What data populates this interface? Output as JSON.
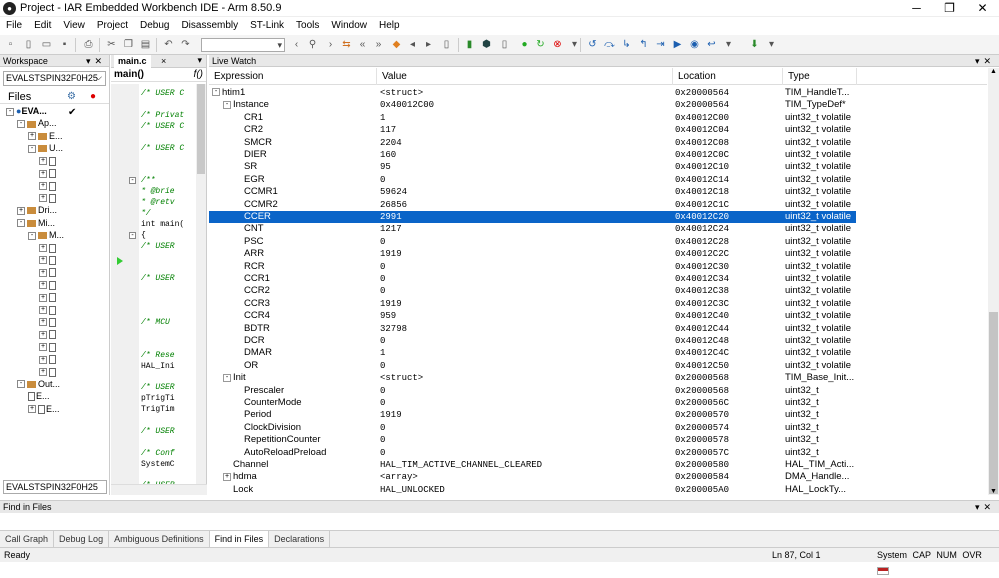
{
  "window": {
    "title": "Project - IAR Embedded Workbench IDE - Arm 8.50.9",
    "app_icon": "iar-app-icon"
  },
  "menu": [
    "File",
    "Edit",
    "View",
    "Project",
    "Debug",
    "Disassembly",
    "ST-Link",
    "Tools",
    "Window",
    "Help"
  ],
  "workspace": {
    "header": "Workspace",
    "config": "EVALSTSPIN32F0H25",
    "files_label": "Files",
    "bottom_tab": "EVALSTSPIN32F0H25",
    "tree": [
      {
        "label": "EVA...",
        "depth": 0,
        "type": "project",
        "sign": "-"
      },
      {
        "label": "Ap...",
        "depth": 1,
        "type": "folder",
        "sign": "-"
      },
      {
        "label": "E...",
        "depth": 2,
        "type": "folder",
        "sign": "+"
      },
      {
        "label": "U...",
        "depth": 2,
        "type": "folder",
        "sign": "-"
      },
      {
        "label": "",
        "depth": 3,
        "type": "file",
        "sign": "+"
      },
      {
        "label": "",
        "depth": 3,
        "type": "file",
        "sign": "+"
      },
      {
        "label": "",
        "depth": 3,
        "type": "file",
        "sign": "+"
      },
      {
        "label": "",
        "depth": 3,
        "type": "file",
        "sign": "+"
      },
      {
        "label": "Dri...",
        "depth": 1,
        "type": "folder",
        "sign": "+"
      },
      {
        "label": "Mi...",
        "depth": 1,
        "type": "folder",
        "sign": "-"
      },
      {
        "label": "M...",
        "depth": 2,
        "type": "folder",
        "sign": "-"
      },
      {
        "label": "",
        "depth": 3,
        "type": "file",
        "sign": "+"
      },
      {
        "label": "",
        "depth": 3,
        "type": "file",
        "sign": "+"
      },
      {
        "label": "",
        "depth": 3,
        "type": "file",
        "sign": "+"
      },
      {
        "label": "",
        "depth": 3,
        "type": "file",
        "sign": "+"
      },
      {
        "label": "",
        "depth": 3,
        "type": "file",
        "sign": "+"
      },
      {
        "label": "",
        "depth": 3,
        "type": "file",
        "sign": "+"
      },
      {
        "label": "",
        "depth": 3,
        "type": "file",
        "sign": "+"
      },
      {
        "label": "",
        "depth": 3,
        "type": "file",
        "sign": "+"
      },
      {
        "label": "",
        "depth": 3,
        "type": "file",
        "sign": "+"
      },
      {
        "label": "",
        "depth": 3,
        "type": "file",
        "sign": "+"
      },
      {
        "label": "",
        "depth": 3,
        "type": "file",
        "sign": "+"
      },
      {
        "label": "Out...",
        "depth": 1,
        "type": "folder",
        "sign": "-"
      },
      {
        "label": "E...",
        "depth": 2,
        "type": "file",
        "sign": ""
      },
      {
        "label": "E...",
        "depth": 2,
        "type": "file",
        "sign": "+"
      }
    ]
  },
  "editor": {
    "tab": "main.c",
    "tab_close": "×",
    "function": "main()",
    "fn_icon": "f()",
    "lines": [
      {
        "t": "/* USER C",
        "c": true
      },
      {
        "t": "",
        "c": false
      },
      {
        "t": "/* Privat",
        "c": true
      },
      {
        "t": "/* USER C",
        "c": true
      },
      {
        "t": "",
        "c": false
      },
      {
        "t": "/* USER C",
        "c": true
      },
      {
        "t": "",
        "c": false
      },
      {
        "t": "",
        "c": false
      },
      {
        "t": "/**",
        "c": true
      },
      {
        "t": "  * @brie",
        "c": true
      },
      {
        "t": "  * @retv",
        "c": true
      },
      {
        "t": "  */",
        "c": true
      },
      {
        "t": "int main(",
        "c": false
      },
      {
        "t": "{",
        "c": false
      },
      {
        "t": "  /* USER",
        "c": true
      },
      {
        "t": "",
        "c": false
      },
      {
        "t": "",
        "c": false
      },
      {
        "t": "  /* USER",
        "c": true
      },
      {
        "t": "",
        "c": false
      },
      {
        "t": "",
        "c": false
      },
      {
        "t": "",
        "c": false
      },
      {
        "t": "  /* MCU",
        "c": true
      },
      {
        "t": "",
        "c": false
      },
      {
        "t": "",
        "c": false
      },
      {
        "t": "  /* Rese",
        "c": true
      },
      {
        "t": "  HAL_Ini",
        "c": false
      },
      {
        "t": "",
        "c": false
      },
      {
        "t": "  /* USER",
        "c": true
      },
      {
        "t": "  pTrigTi",
        "c": false
      },
      {
        "t": "  TrigTim",
        "c": false
      },
      {
        "t": "",
        "c": false
      },
      {
        "t": "  /* USER",
        "c": true
      },
      {
        "t": "",
        "c": false
      },
      {
        "t": "  /* Conf",
        "c": true
      },
      {
        "t": "  SystemC",
        "c": false
      },
      {
        "t": "",
        "c": false
      },
      {
        "t": "  /* USER",
        "c": true
      }
    ]
  },
  "watch": {
    "header": "Live Watch",
    "columns": [
      "Expression",
      "Value",
      "Location",
      "Type"
    ],
    "rows": [
      {
        "e": "htim1",
        "d": 0,
        "s": "-",
        "v": "<struct>",
        "l": "0x20000564",
        "t": "TIM_HandleT..."
      },
      {
        "e": "Instance",
        "d": 1,
        "s": "-",
        "v": "0x40012C00",
        "l": "0x20000564",
        "t": "TIM_TypeDef*"
      },
      {
        "e": "CR1",
        "d": 2,
        "s": "",
        "v": "1",
        "l": "0x40012C00",
        "t": "uint32_t volatile"
      },
      {
        "e": "CR2",
        "d": 2,
        "s": "",
        "v": "117",
        "l": "0x40012C04",
        "t": "uint32_t volatile"
      },
      {
        "e": "SMCR",
        "d": 2,
        "s": "",
        "v": "2204",
        "l": "0x40012C08",
        "t": "uint32_t volatile"
      },
      {
        "e": "DIER",
        "d": 2,
        "s": "",
        "v": "160",
        "l": "0x40012C0C",
        "t": "uint32_t volatile"
      },
      {
        "e": "SR",
        "d": 2,
        "s": "",
        "v": "95",
        "l": "0x40012C10",
        "t": "uint32_t volatile"
      },
      {
        "e": "EGR",
        "d": 2,
        "s": "",
        "v": "0",
        "l": "0x40012C14",
        "t": "uint32_t volatile"
      },
      {
        "e": "CCMR1",
        "d": 2,
        "s": "",
        "v": "59624",
        "l": "0x40012C18",
        "t": "uint32_t volatile"
      },
      {
        "e": "CCMR2",
        "d": 2,
        "s": "",
        "v": "26856",
        "l": "0x40012C1C",
        "t": "uint32_t volatile"
      },
      {
        "e": "CCER",
        "d": 2,
        "s": "",
        "v": "2991",
        "l": "0x40012C20",
        "t": "uint32_t volatile",
        "sel": true
      },
      {
        "e": "CNT",
        "d": 2,
        "s": "",
        "v": "1217",
        "l": "0x40012C24",
        "t": "uint32_t volatile"
      },
      {
        "e": "PSC",
        "d": 2,
        "s": "",
        "v": "0",
        "l": "0x40012C28",
        "t": "uint32_t volatile"
      },
      {
        "e": "ARR",
        "d": 2,
        "s": "",
        "v": "1919",
        "l": "0x40012C2C",
        "t": "uint32_t volatile"
      },
      {
        "e": "RCR",
        "d": 2,
        "s": "",
        "v": "0",
        "l": "0x40012C30",
        "t": "uint32_t volatile"
      },
      {
        "e": "CCR1",
        "d": 2,
        "s": "",
        "v": "0",
        "l": "0x40012C34",
        "t": "uint32_t volatile"
      },
      {
        "e": "CCR2",
        "d": 2,
        "s": "",
        "v": "0",
        "l": "0x40012C38",
        "t": "uint32_t volatile"
      },
      {
        "e": "CCR3",
        "d": 2,
        "s": "",
        "v": "1919",
        "l": "0x40012C3C",
        "t": "uint32_t volatile"
      },
      {
        "e": "CCR4",
        "d": 2,
        "s": "",
        "v": "959",
        "l": "0x40012C40",
        "t": "uint32_t volatile"
      },
      {
        "e": "BDTR",
        "d": 2,
        "s": "",
        "v": "32798",
        "l": "0x40012C44",
        "t": "uint32_t volatile"
      },
      {
        "e": "DCR",
        "d": 2,
        "s": "",
        "v": "0",
        "l": "0x40012C48",
        "t": "uint32_t volatile"
      },
      {
        "e": "DMAR",
        "d": 2,
        "s": "",
        "v": "1",
        "l": "0x40012C4C",
        "t": "uint32_t volatile"
      },
      {
        "e": "OR",
        "d": 2,
        "s": "",
        "v": "0",
        "l": "0x40012C50",
        "t": "uint32_t volatile"
      },
      {
        "e": "Init",
        "d": 1,
        "s": "-",
        "v": "<struct>",
        "l": "0x20000568",
        "t": "TIM_Base_Init..."
      },
      {
        "e": "Prescaler",
        "d": 2,
        "s": "",
        "v": "0",
        "l": "0x20000568",
        "t": "uint32_t"
      },
      {
        "e": "CounterMode",
        "d": 2,
        "s": "",
        "v": "0",
        "l": "0x2000056C",
        "t": "uint32_t"
      },
      {
        "e": "Period",
        "d": 2,
        "s": "",
        "v": "1919",
        "l": "0x20000570",
        "t": "uint32_t"
      },
      {
        "e": "ClockDivision",
        "d": 2,
        "s": "",
        "v": "0",
        "l": "0x20000574",
        "t": "uint32_t"
      },
      {
        "e": "RepetitionCounter",
        "d": 2,
        "s": "",
        "v": "0",
        "l": "0x20000578",
        "t": "uint32_t"
      },
      {
        "e": "AutoReloadPreload",
        "d": 2,
        "s": "",
        "v": "0",
        "l": "0x2000057C",
        "t": "uint32_t"
      },
      {
        "e": "Channel",
        "d": 1,
        "s": "",
        "v": "HAL_TIM_ACTIVE_CHANNEL_CLEARED",
        "l": "0x20000580",
        "t": "HAL_TIM_Acti..."
      },
      {
        "e": "hdma",
        "d": 1,
        "s": "+",
        "v": "<array>",
        "l": "0x20000584",
        "t": "DMA_Handle..."
      },
      {
        "e": "Lock",
        "d": 1,
        "s": "",
        "v": "HAL_UNLOCKED",
        "l": "0x200005A0",
        "t": "HAL_LockTy..."
      }
    ]
  },
  "find": {
    "header": "Find in Files"
  },
  "bottom_tabs": [
    "Call Graph",
    "Debug Log",
    "Ambiguous Definitions",
    "Find in Files",
    "Declarations"
  ],
  "active_tab": "Find in Files",
  "status": {
    "left": "Ready",
    "pos": "Ln 87, Col 1",
    "right": "System  CAP  NUM  OVR"
  },
  "colors": {
    "selection": "#0a64c8",
    "comment": "#008000",
    "folder": "#c98c3c"
  }
}
